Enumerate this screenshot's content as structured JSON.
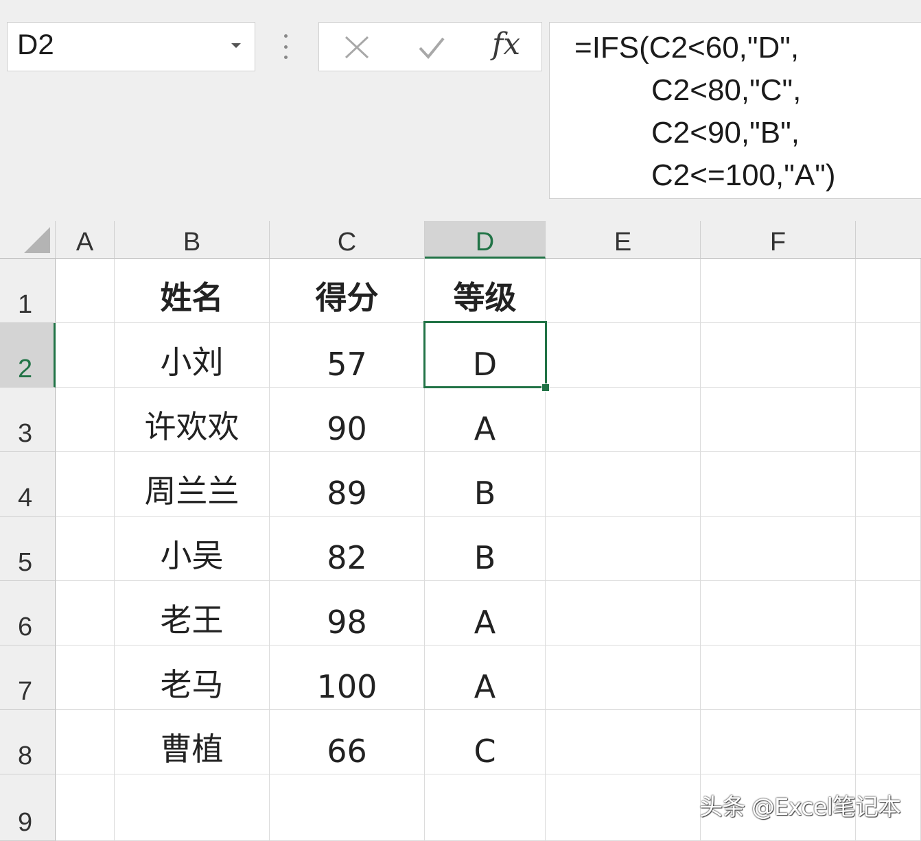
{
  "name_box": {
    "value": "D2"
  },
  "formula_bar": {
    "cancel_icon": "x-icon",
    "enter_icon": "check-icon",
    "fx_label": "fx",
    "lines": [
      "=IFS(C2<60,\"D\",",
      "C2<80,\"C\",",
      "C2<90,\"B\",",
      "C2<=100,\"A\")"
    ]
  },
  "columns": [
    "A",
    "B",
    "C",
    "D",
    "E",
    "F"
  ],
  "selected_column": "D",
  "rows": [
    "1",
    "2",
    "3",
    "4",
    "5",
    "6",
    "7",
    "8",
    "9"
  ],
  "selected_row": "2",
  "table": {
    "headers": [
      "姓名",
      "得分",
      "等级"
    ],
    "data": [
      [
        "小刘",
        "57",
        "D"
      ],
      [
        "许欢欢",
        "90",
        "A"
      ],
      [
        "周兰兰",
        "89",
        "B"
      ],
      [
        "小吴",
        "82",
        "B"
      ],
      [
        "老王",
        "98",
        "A"
      ],
      [
        "老马",
        "100",
        "A"
      ],
      [
        "曹植",
        "66",
        "C"
      ]
    ]
  },
  "watermark": "头条 @Excel笔记本",
  "colors": {
    "accent": "#217346",
    "header_bg": "#efefef",
    "selected_header_bg": "#d4d4d4"
  }
}
